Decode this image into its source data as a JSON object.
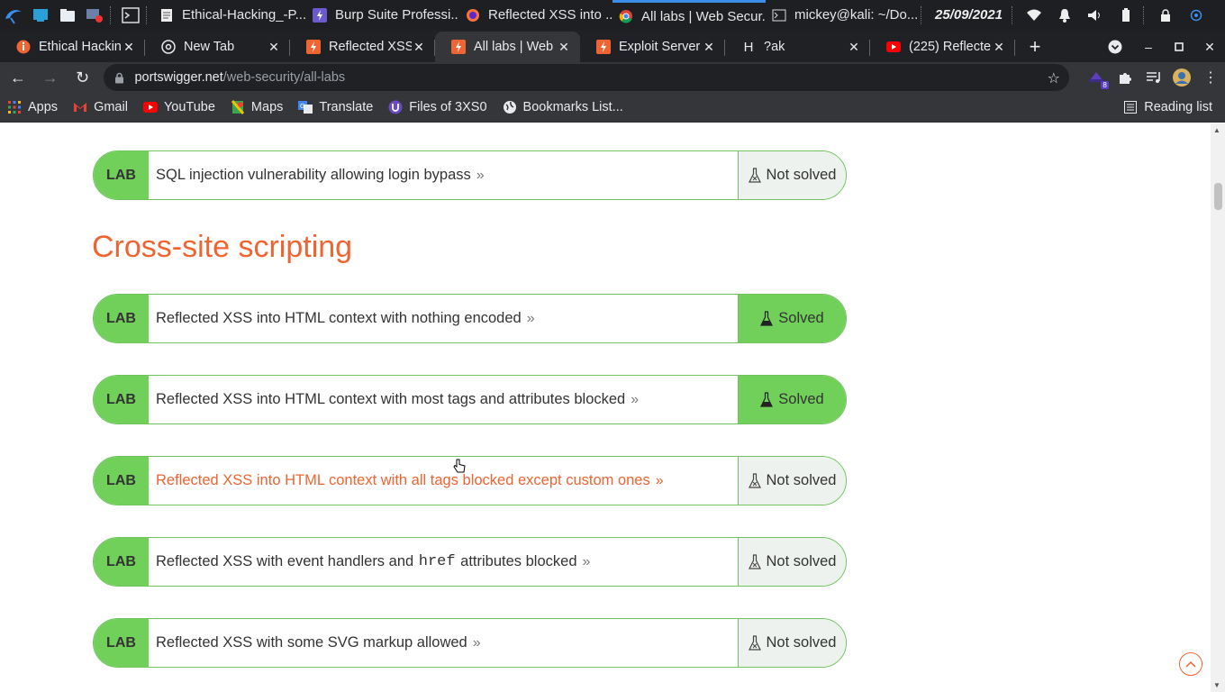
{
  "taskbar": {
    "windows": [
      {
        "label": "Ethical-Hacking_-P...",
        "icon": "document-icon"
      },
      {
        "label": "Burp Suite Professi...",
        "icon": "burp-icon"
      },
      {
        "label": "Reflected XSS into ...",
        "icon": "firefox-icon"
      },
      {
        "label": "All labs | Web Secur...",
        "icon": "chrome-icon"
      },
      {
        "label": "mickey@kali: ~/Do...",
        "icon": "terminal-icon"
      }
    ],
    "date": "25/09/2021"
  },
  "tabs": [
    {
      "label": "Ethical Hackin",
      "icon": "portswigger-info-icon"
    },
    {
      "label": "New Tab",
      "icon": "chrome-icon"
    },
    {
      "label": "Reflected XSS",
      "icon": "portswigger-icon"
    },
    {
      "label": "All labs | Web",
      "icon": "portswigger-icon",
      "active": true
    },
    {
      "label": "Exploit Server",
      "icon": "portswigger-icon"
    },
    {
      "label": "?ak",
      "icon": "h-icon",
      "prefix": "H"
    },
    {
      "label": "(225) Reflecte",
      "icon": "youtube-icon"
    }
  ],
  "address": {
    "host": "portswigger.net",
    "path": "/web-security/all-labs"
  },
  "extensions_badge": "8",
  "bookmarks": [
    {
      "label": "Apps",
      "icon": "apps-grid-icon"
    },
    {
      "label": "Gmail",
      "icon": "gmail-icon"
    },
    {
      "label": "YouTube",
      "icon": "youtube-icon"
    },
    {
      "label": "Maps",
      "icon": "maps-icon"
    },
    {
      "label": "Translate",
      "icon": "translate-icon"
    },
    {
      "label": "Files of 3XS0",
      "icon": "u-icon"
    },
    {
      "label": "Bookmarks List...",
      "icon": "globe-icon"
    }
  ],
  "reading_list": "Reading list",
  "page": {
    "section_heading": "Cross-site scripting",
    "badge": "LAB",
    "labs": [
      {
        "title": "SQL injection vulnerability allowing login bypass",
        "status": "Not solved"
      },
      {
        "title": "Reflected XSS into HTML context with nothing encoded",
        "status": "Solved"
      },
      {
        "title": "Reflected XSS into HTML context with most tags and attributes blocked",
        "status": "Solved"
      },
      {
        "title": "Reflected XSS into HTML context with all tags blocked except custom ones",
        "status": "Not solved"
      },
      {
        "title_before": "Reflected XSS with event handlers and",
        "title_code": "href",
        "title_after": "attributes blocked",
        "status": "Not solved"
      },
      {
        "title": "Reflected XSS with some SVG markup allowed",
        "status": "Not solved"
      }
    ]
  },
  "colors": {
    "accent": "#ee6432",
    "lab_green": "#70d05a",
    "not_solved_bg": "#eef2ef"
  }
}
